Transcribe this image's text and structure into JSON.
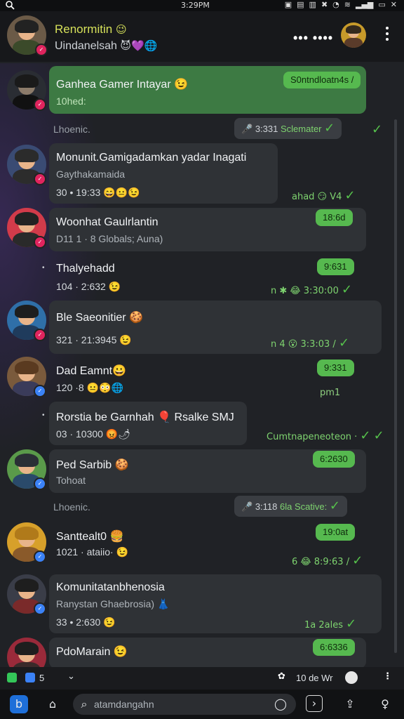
{
  "status_bar": {
    "time": "3:29PM",
    "left_icon": "search-icon"
  },
  "header": {
    "title": "Renormitin",
    "title_emoji": "😉",
    "subtitle": "Uindanelsah",
    "subtitle_emoji": "😈💜🌐",
    "dots": "••• ••••"
  },
  "chats": [
    {
      "name": "Ganhea Gamer Intayar 😉",
      "sub": "10hed:",
      "pill": "S0ntndloatn4s /",
      "green": true
    },
    {
      "separator": "Lhoenic.",
      "box": "3:331",
      "box_label": "Sclemater"
    },
    {
      "name": "Monunit.Gamigadamkan yadar Inagati",
      "sub": "Gaythakamaida",
      "line3": "30 • 19:33 😄😐😉",
      "meta": "ahad 😏 V4"
    },
    {
      "name": "Woonhat Gaulrlantin",
      "sub": "D11 1 · 8 Globals; Auna)",
      "pill": "18:6d"
    },
    {
      "name": "Thalyehadd",
      "sub": "104 · 2:632 😉",
      "pill": "9:631",
      "meta": "n ✱ 😂 3:30:00"
    },
    {
      "name": "Ble Saeonitier 🍪",
      "sub": "321 · 21:3945 😉",
      "meta": "n 4 😮 3:3:03 /"
    },
    {
      "name": "Dad Eamnt😀",
      "sub": "120 ·8 😐😳🌐",
      "pill": "9:331",
      "meta": "pm1"
    },
    {
      "name": "Rorstia be Garnhah 🎈 Rsalke SMJ",
      "sub": "03 · 10300 😡🌶",
      "meta": "Cumtnapeneoteon ·"
    },
    {
      "name": "Ped Sarbib 🍪",
      "sub": "Tohoat",
      "pill": "6:2630"
    },
    {
      "separator": "Lhoenic.",
      "box": "3:118",
      "box_label": "6la Scative:"
    },
    {
      "name": "Santtealt0 🍔",
      "sub": "1021 · ataiio· 😉",
      "pill": "19:0at",
      "meta": "6 😂 8:9:63 /"
    },
    {
      "name": "Komunitatanbhenosia",
      "sub": "Ranystan Ghaebrosia) 👗",
      "line3": "33 • 2:630 😉",
      "meta": "1a 2ales"
    },
    {
      "name": "PdoMarain 😉",
      "sub": "",
      "pill": "6:6336"
    }
  ],
  "tabstrip": {
    "left": "5",
    "right": "10 de Wr"
  },
  "nav": {
    "search_placeholder": "atamdangahn"
  }
}
